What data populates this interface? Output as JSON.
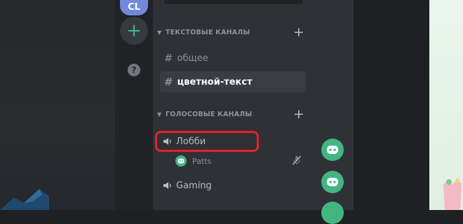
{
  "server_rail": {
    "top_server_initials": "CL",
    "add_server_symbol": "+",
    "help_symbol": "?"
  },
  "categories": {
    "text": {
      "label": "ТЕКСТОВЫЕ КАНАЛЫ",
      "add_symbol": "+"
    },
    "voice": {
      "label": "ГОЛОСОВЫЕ КАНАЛЫ",
      "add_symbol": "+"
    }
  },
  "text_channels": [
    {
      "hash": "#",
      "name": "общее",
      "selected": false
    },
    {
      "hash": "#",
      "name": "цветной-текст",
      "selected": true
    }
  ],
  "voice_channels": [
    {
      "name": "Лобби",
      "highlighted": true,
      "users": [
        "Patts"
      ]
    },
    {
      "name": "Gaming",
      "highlighted": false,
      "users": []
    }
  ],
  "colors": {
    "accent_green": "#43b581",
    "blurple": "#7289da",
    "highlight_red": "#e8202a"
  }
}
